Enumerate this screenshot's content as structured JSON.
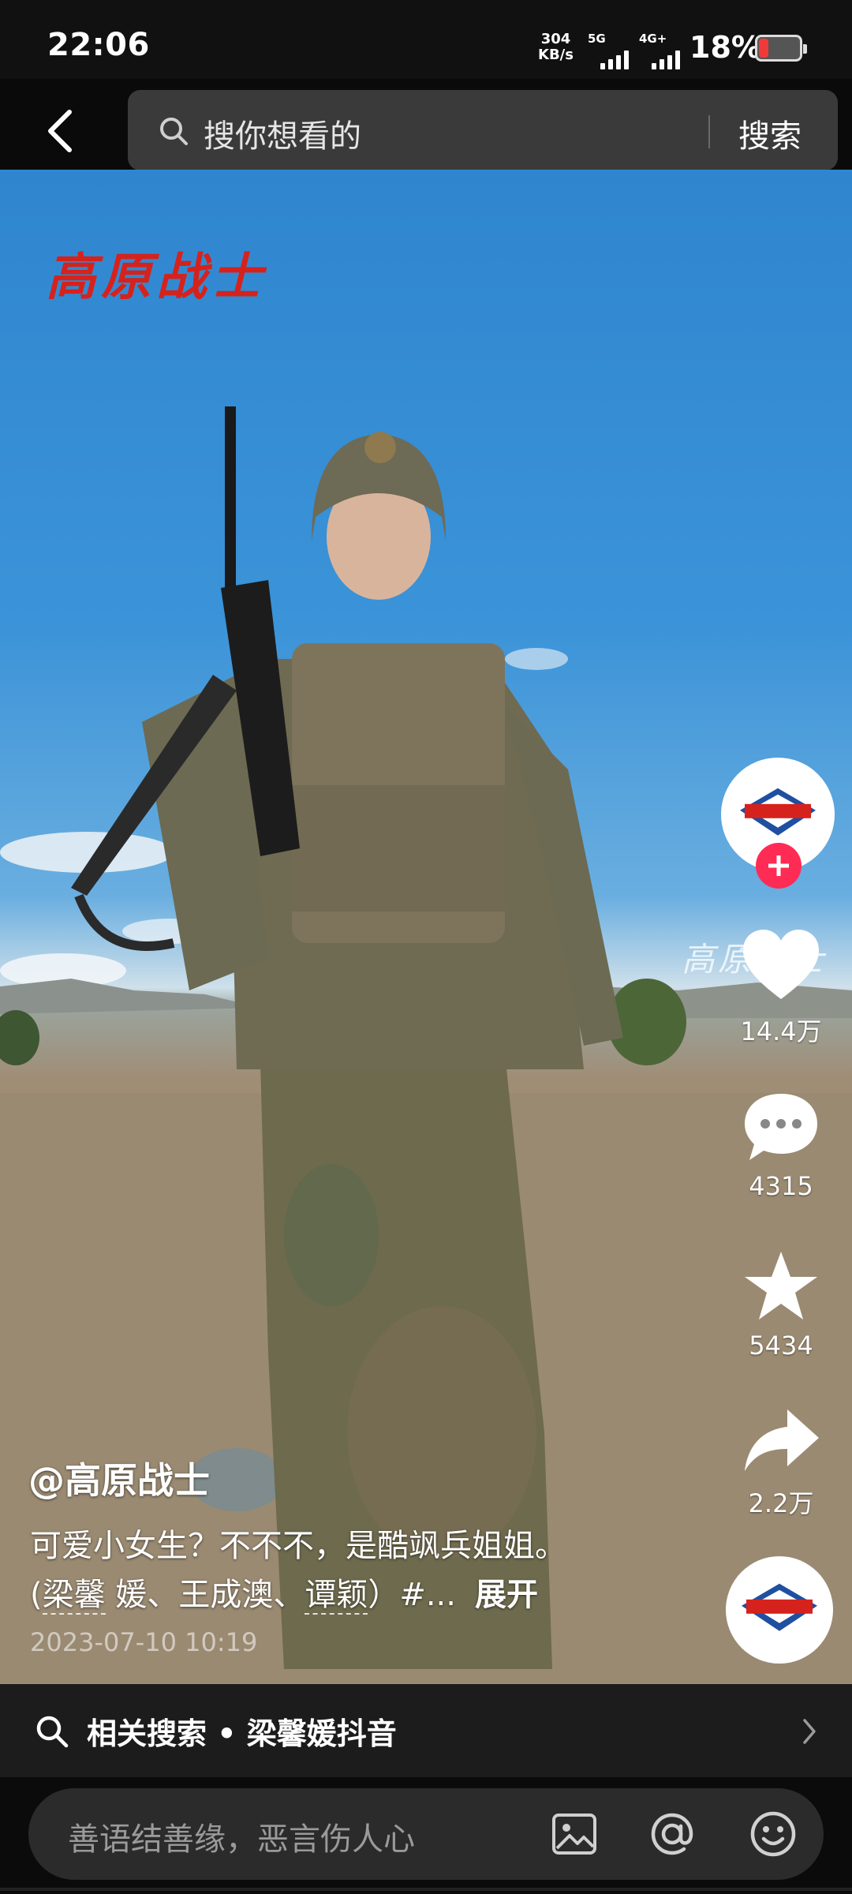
{
  "status_bar": {
    "time": "22:06",
    "net_speed": "304",
    "net_unit": "KB/s",
    "sig1_label": "5G",
    "sig2_label": "4G+",
    "battery": "18%"
  },
  "header": {
    "search_placeholder": "搜你想看的",
    "search_button": "搜索"
  },
  "video": {
    "overlay_logo": "高原战士",
    "watermark": "高原战士"
  },
  "actions": {
    "likes": "14.4万",
    "comments": "4315",
    "favorites": "5434",
    "shares": "2.2万"
  },
  "caption": {
    "author": "@高原战士",
    "line1": "可爱小女生？不不不，是酷飒兵姐姐。",
    "line2_open": "(",
    "tag1": "梁馨",
    "line2_mid": " 媛、王成澳、",
    "tag2": "谭颖",
    "line2_tail": "）#...",
    "expand": "展开",
    "date": "2023-07-10 10:19"
  },
  "related": {
    "text": "相关搜索 • 梁馨媛抖音"
  },
  "comment_bar": {
    "placeholder": "善语结善缘，恶言伤人心"
  },
  "colors": {
    "accent_red": "#fe2c55",
    "logo_red": "#d6221c",
    "search_bg": "#3a3a3a"
  }
}
